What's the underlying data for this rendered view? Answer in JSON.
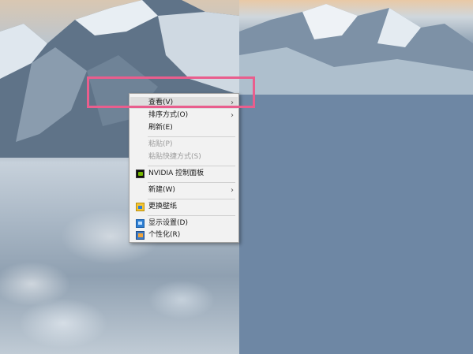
{
  "desktop": {
    "wallpaper_name": "mountain-clouds-wallpaper",
    "solid_color": "#6e87a4",
    "highlight_color": "#e95e8d"
  },
  "context_menu": {
    "items": [
      {
        "label": "查看(V)",
        "submenu": true,
        "icon": null,
        "disabled": false,
        "highlighted": true
      },
      {
        "label": "排序方式(O)",
        "submenu": true,
        "icon": null,
        "disabled": false
      },
      {
        "label": "刷新(E)",
        "submenu": false,
        "icon": null,
        "disabled": false
      },
      {
        "label": "粘贴(P)",
        "submenu": false,
        "icon": null,
        "disabled": true
      },
      {
        "label": "粘贴快捷方式(S)",
        "submenu": false,
        "icon": null,
        "disabled": true
      },
      {
        "label": "NVIDIA 控制面板",
        "submenu": false,
        "icon": "nvidia-icon",
        "disabled": false
      },
      {
        "label": "新建(W)",
        "submenu": true,
        "icon": null,
        "disabled": false
      },
      {
        "label": "更换壁纸",
        "submenu": false,
        "icon": "wallpaper-icon",
        "disabled": false
      },
      {
        "label": "显示设置(D)",
        "submenu": false,
        "icon": "display-icon",
        "disabled": false
      },
      {
        "label": "个性化(R)",
        "submenu": false,
        "icon": "personalize-icon",
        "disabled": false
      }
    ],
    "submenu_arrow": "›"
  }
}
